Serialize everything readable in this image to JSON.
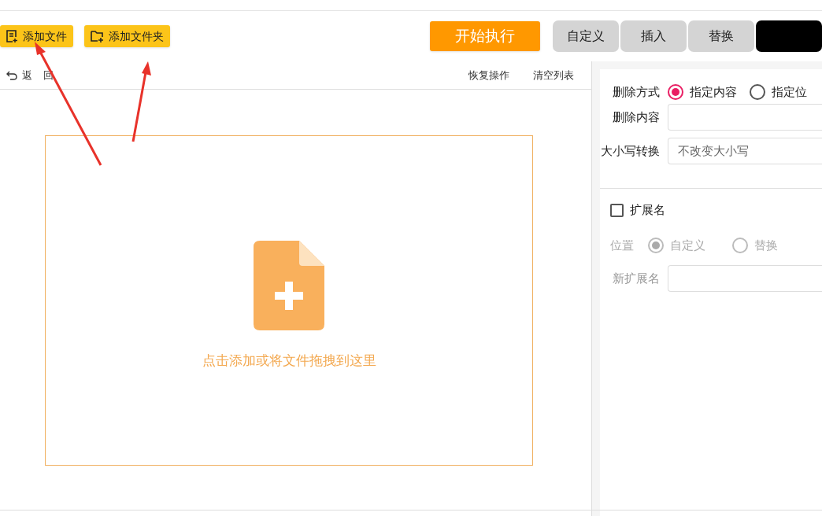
{
  "toolbar": {
    "buttons": [
      {
        "label": "添加文件",
        "kind": "file"
      },
      {
        "label": "添加文件夹",
        "kind": "folder"
      }
    ],
    "start_button": "开始执行"
  },
  "tabs": [
    {
      "label": "自定义",
      "selected": false
    },
    {
      "label": "插入",
      "selected": false
    },
    {
      "label": "替换",
      "selected": false
    },
    {
      "selected": true
    }
  ],
  "list_actions": {
    "left": [
      "返",
      "回"
    ],
    "right": [
      "恢复操作",
      "清空列表"
    ]
  },
  "drop_zone": {
    "hint": "点击添加或将文件拖拽到这里"
  },
  "settings": {
    "delete_mode": {
      "label": "删除方式",
      "options": [
        {
          "label": "指定内容",
          "selected": true
        },
        {
          "label": "指定位",
          "selected": false
        }
      ]
    },
    "delete_content": {
      "label": "删除内容"
    },
    "case": {
      "label": "大小写转换",
      "value": "不改变大小写"
    },
    "extension": {
      "label": "扩展名",
      "checked": false,
      "position": {
        "label": "位置",
        "options": [
          {
            "label": "自定义",
            "selected": true
          },
          {
            "label": "替换",
            "selected": false
          }
        ]
      },
      "new_ext": {
        "label": "新扩展名"
      }
    }
  }
}
